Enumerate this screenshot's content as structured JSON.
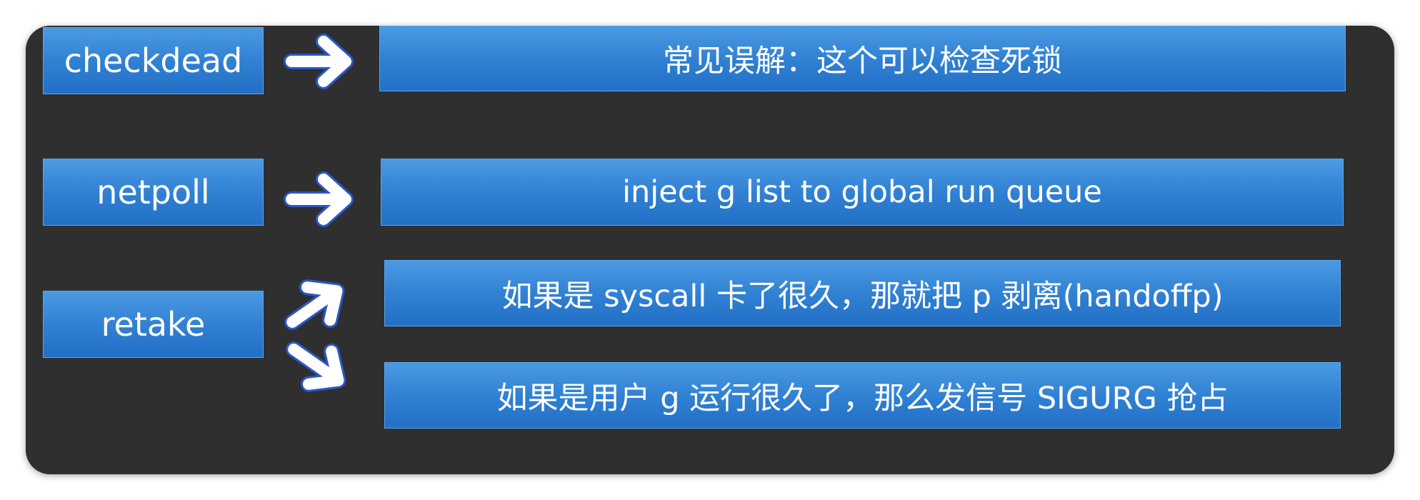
{
  "diagram": {
    "rows": [
      {
        "label": "checkdead",
        "descriptions": [
          "常见误解：这个可以检查死锁"
        ]
      },
      {
        "label": "netpoll",
        "descriptions": [
          "inject g list to global run queue"
        ]
      },
      {
        "label": "retake",
        "descriptions": [
          "如果是 syscall 卡了很久，那就把 p 剥离(handoffp)",
          "如果是用户 g 运行很久了，那么发信号 SIGURG 抢占"
        ]
      }
    ],
    "colors": {
      "panel_background": "#2f2f2f",
      "box_blue": "#2f7fd2",
      "arrow_fill": "#ffffff",
      "arrow_outline": "#2a57c9",
      "text": "#ffffff"
    }
  }
}
